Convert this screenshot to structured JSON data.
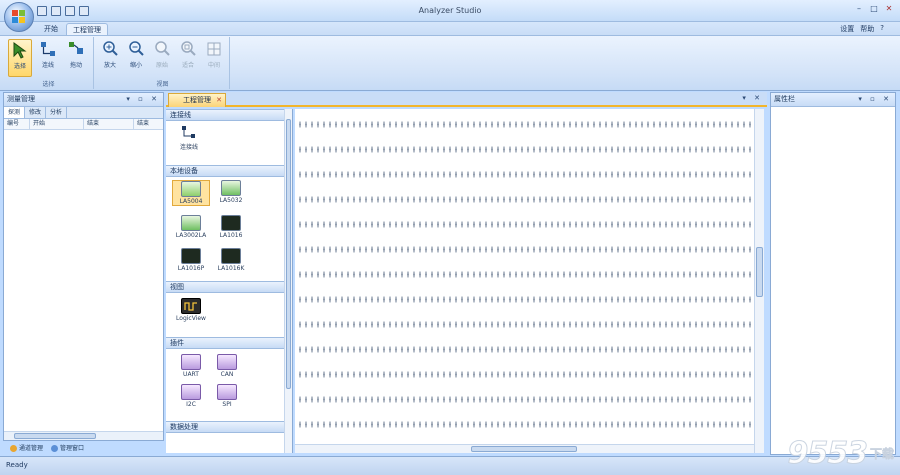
{
  "app": {
    "title": "Analyzer Studio"
  },
  "ribbon": {
    "tabs": [
      {
        "label": "开始",
        "active": false
      },
      {
        "label": "工程管理",
        "active": true
      }
    ],
    "right_links": [
      "设置",
      "帮助",
      "?"
    ],
    "groups": [
      {
        "label": "选择",
        "buttons": [
          "选择",
          "连线",
          "拖动"
        ]
      },
      {
        "label": "视图",
        "buttons": [
          "放大",
          "缩小",
          "原始",
          "适合",
          "中间"
        ]
      }
    ]
  },
  "left_panel": {
    "title": "测量管理",
    "tabs": [
      "探测",
      "修改",
      "分析"
    ],
    "columns": [
      "编号",
      "开始",
      "结束",
      "结束"
    ],
    "bottom_tabs": [
      "通道管理",
      "管理窗口"
    ]
  },
  "document_tab": {
    "label": "工程管理"
  },
  "toolbox": {
    "categories": [
      {
        "label": "连接线",
        "items": [
          "连接线"
        ]
      },
      {
        "label": "本地设备",
        "items": [
          "LA5004",
          "LA5032",
          "LA3002LA",
          "LA1016",
          "LA1016P",
          "LA1016K"
        ]
      },
      {
        "label": "视图",
        "items": [
          "LogicView"
        ]
      },
      {
        "label": "插件",
        "items": [
          "UART",
          "CAN",
          "I2C",
          "SPI"
        ]
      },
      {
        "label": "数据处理",
        "items": []
      }
    ]
  },
  "right_panel": {
    "title": "属性栏"
  },
  "status_bar": {
    "text": "Ready"
  },
  "watermark": {
    "number": "9553",
    "text": "下载"
  },
  "colors": {
    "accent": "#f2b52b",
    "frame": "#8aaad4",
    "ribbon_bg": "#d3e3f8"
  }
}
